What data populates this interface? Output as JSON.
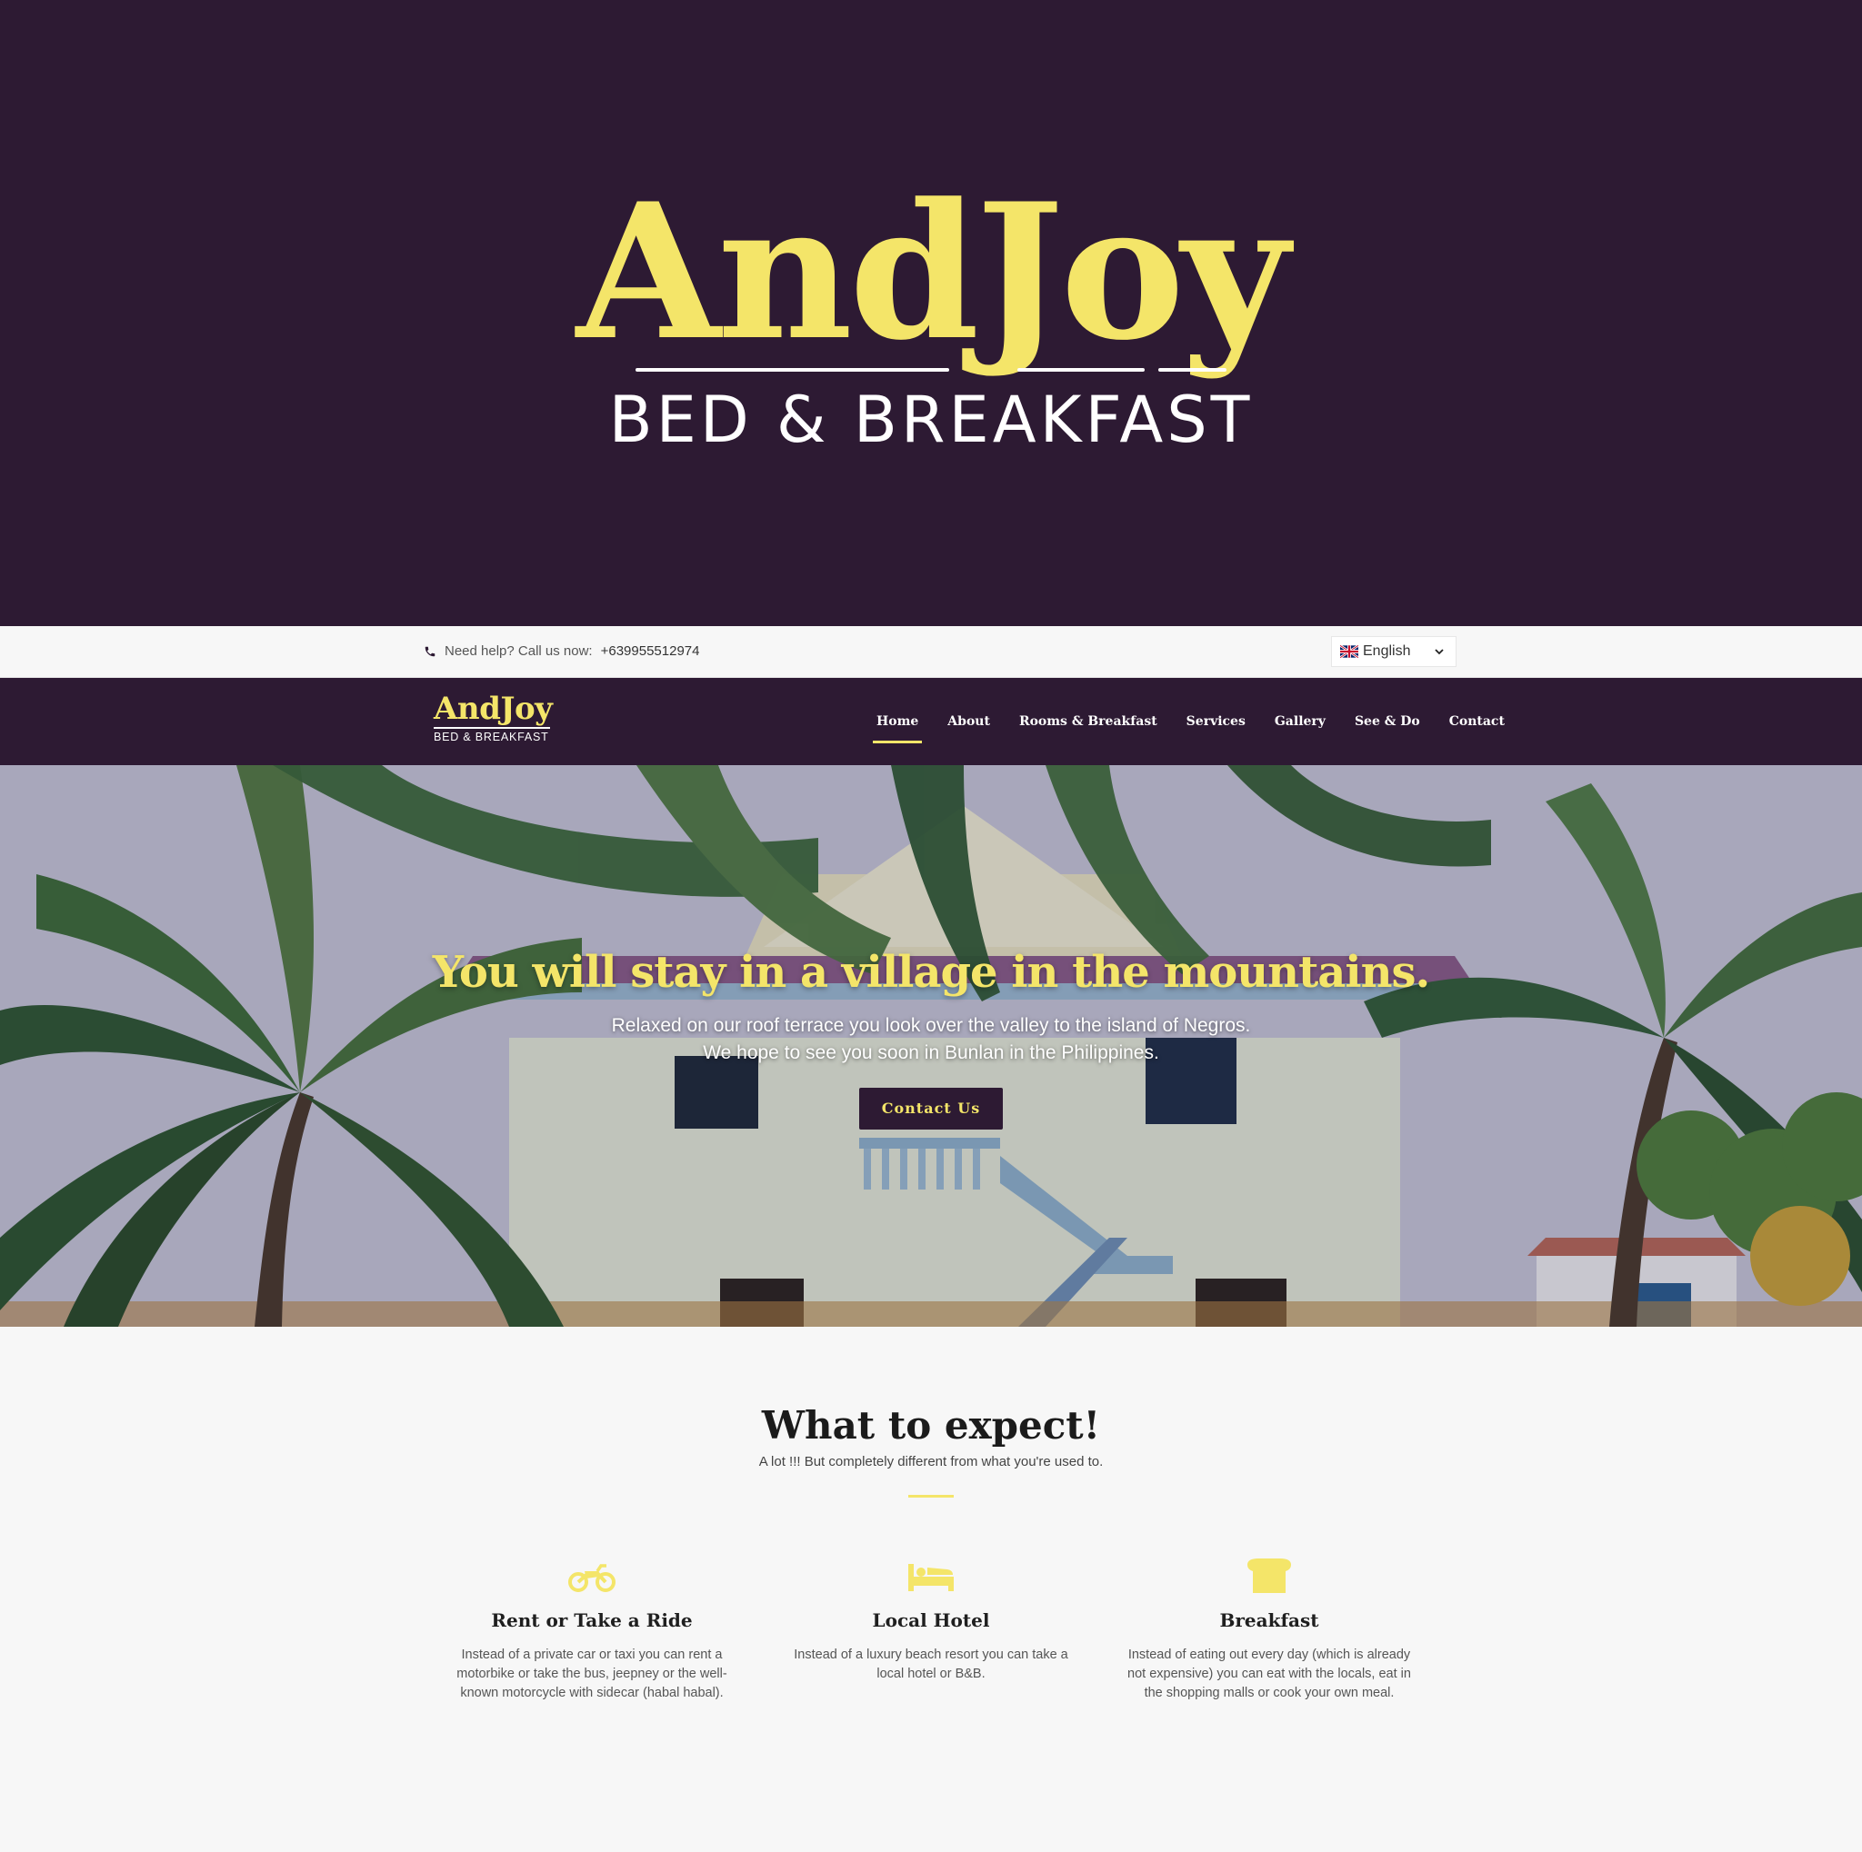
{
  "brand": {
    "name": "AndJoy",
    "tagline": "BED & BREAKFAST",
    "accent_color": "#f4e569",
    "dark_color": "#2d1a33"
  },
  "topbar": {
    "help_text": "Need help? Call us now:",
    "phone": "+639955512974",
    "phone_icon": "phone-icon",
    "language": "English",
    "language_flag": "uk-flag-icon"
  },
  "nav": {
    "items": [
      {
        "label": "Home",
        "active": true
      },
      {
        "label": "About"
      },
      {
        "label": "Rooms & Breakfast"
      },
      {
        "label": "Services"
      },
      {
        "label": "Gallery"
      },
      {
        "label": "See & Do"
      },
      {
        "label": "Contact"
      }
    ]
  },
  "hero": {
    "title": "You will stay in a village in the mountains.",
    "subtitle_line1": "Relaxed on our roof terrace you look over the valley to the island of Negros.",
    "subtitle_line2": "We hope to see you soon in Bunlan in the Philippines.",
    "button_label": "Contact Us"
  },
  "expect": {
    "title": "What to expect!",
    "subtitle": "A lot !!! But completely different from what you're used to.",
    "features": [
      {
        "icon": "motorcycle-icon",
        "title": "Rent or Take a Ride",
        "text": "Instead of a private car or taxi you can rent a motorbike or take the bus, jeepney or the well-known motorcycle with sidecar (habal habal)."
      },
      {
        "icon": "bed-icon",
        "title": "Local Hotel",
        "text": "Instead of a luxury beach resort you can take a local hotel or B&B."
      },
      {
        "icon": "bread-icon",
        "title": "Breakfast",
        "text": "Instead of eating out every day (which is already not expensive) you can eat with the locals, eat in the shopping malls or cook your own meal."
      }
    ]
  }
}
